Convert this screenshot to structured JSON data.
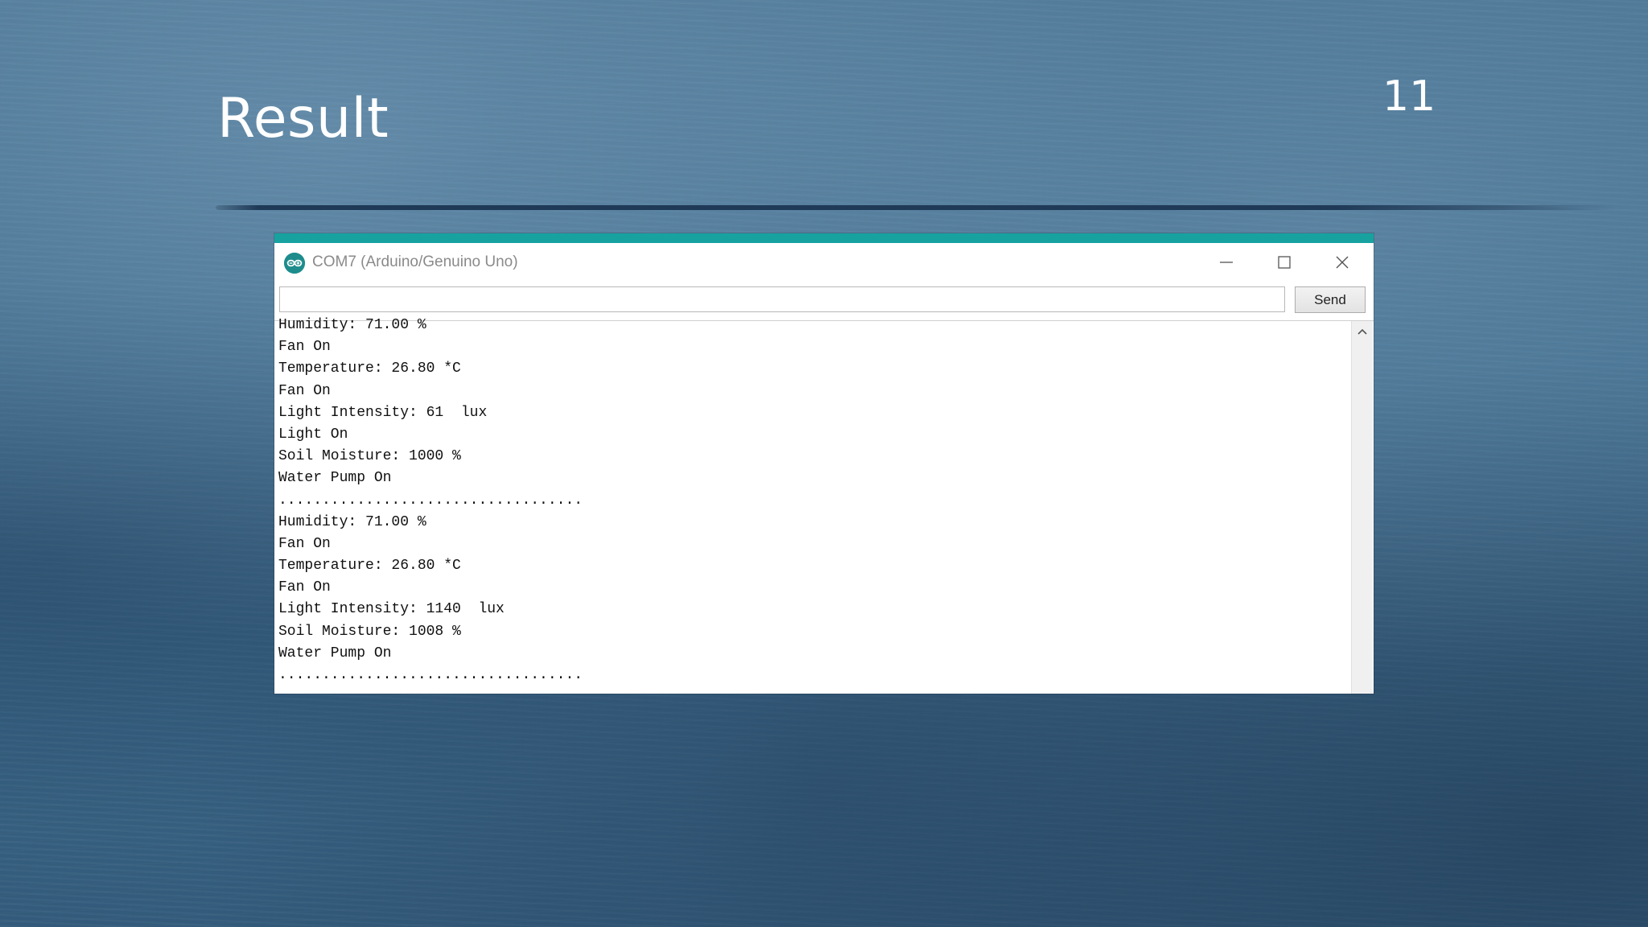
{
  "slide": {
    "title": "Result",
    "number": "11"
  },
  "window": {
    "title": "COM7 (Arduino/Genuino Uno)",
    "app_icon": "arduino-icon",
    "controls": [
      "minimize-icon",
      "maximize-icon",
      "close-icon"
    ],
    "accent_color": "#17a2a0"
  },
  "send_bar": {
    "input_value": "",
    "send_label": "Send"
  },
  "output": {
    "lines": [
      "Humidity: 71.00 %",
      "Fan On",
      "Temperature: 26.80 *C",
      "Fan On",
      "Light Intensity: 61  lux",
      "Light On",
      "Soil Moisture: 1000 %",
      "Water Pump On",
      "...................................",
      "Humidity: 71.00 %",
      "Fan On",
      "Temperature: 26.80 *C",
      "Fan On",
      "Light Intensity: 1140  lux",
      "Soil Moisture: 1008 %",
      "Water Pump On",
      "..................................."
    ]
  }
}
